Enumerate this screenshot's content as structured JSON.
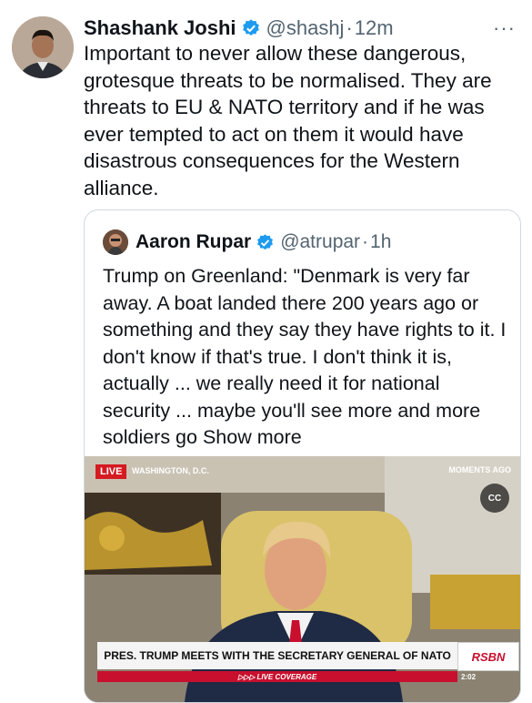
{
  "tweet": {
    "name": "Shashank Joshi",
    "handle": "@shashj",
    "separator": "·",
    "time": "12m",
    "menu": "···",
    "text": "Important to never allow these dangerous, grotesque threats to be normalised. They are threats to EU & NATO territory and if he was ever tempted to act on them it would have disastrous consequences for the Western alliance."
  },
  "quote": {
    "name": "Aaron Rupar",
    "handle": "@atrupar",
    "separator": "·",
    "time": "1h",
    "text": "Trump on Greenland: \"Denmark is very far away. A boat landed there 200 years ago or something and they say they have rights to it. I don't know if that's true. I don't think it is, actually ... we really need it for national security ... maybe you'll see more and more soldiers go ",
    "show_more": "Show more"
  },
  "video": {
    "live_label": "LIVE",
    "location": "WASHINGTON, D.C.",
    "moments": "MOMENTS AGO",
    "cc": "CC",
    "headline": "PRES. TRUMP MEETS WITH THE SECRETARY GENERAL OF NATO",
    "network": "RSBN",
    "live_coverage": "▷▷▷ LIVE COVERAGE",
    "timestamp": "2:02"
  },
  "colors": {
    "verified": "#1d9bf0",
    "muted": "#536471",
    "border": "#cfd9de",
    "live_red": "#d51a22"
  },
  "icons": [
    "verified-badge-icon",
    "more-options-icon",
    "closed-captions-icon"
  ]
}
